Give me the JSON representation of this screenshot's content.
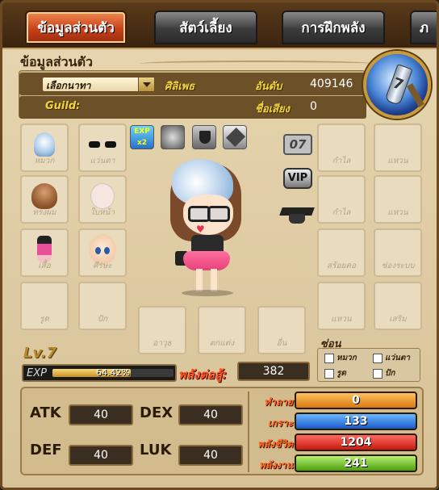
{
  "tabs": [
    {
      "label": "ข้อมูลส่วนตัว"
    },
    {
      "label": "สัตว์เลี้ยง"
    },
    {
      "label": "การฝึกพลัง"
    },
    {
      "label": "ภ"
    }
  ],
  "section_title": "ข้อมูลส่วนตัว",
  "info": {
    "name": "เลือกนาทา",
    "job": "ศิลิเพธ",
    "rank_label": "อันดับ",
    "rank_value": "409146",
    "guild_label": "Guild:",
    "guild_rank_label": "ชื่อเสียง",
    "guild_rank_value": "0"
  },
  "emblem": {
    "number": "7"
  },
  "left_slots": [
    "หมวก",
    "แว่นตา",
    "ทรงผม",
    "ใบหน้า",
    "เสื้อ",
    "ศีรษะ",
    "รูด",
    "ปัก"
  ],
  "right_slots": [
    "กำไล",
    "แหวน",
    "กำไล",
    "แหวน",
    "สร้อยคอ",
    "ช่องระบบ",
    "แหวน",
    "เสริม"
  ],
  "bottom_slots": [
    "อาวุธ",
    "ตกแต่ง",
    "อื่น"
  ],
  "status_icons": {
    "exp_label": "EXP x2"
  },
  "badges": {
    "level_badge": "07",
    "vip_label": "VIP"
  },
  "level": "Lv.7",
  "exp": {
    "label": "EXP",
    "percent_text": "64.42%",
    "fraction": 0.6442
  },
  "power": {
    "label": "พลังต่อสู้:",
    "value": "382"
  },
  "filter": {
    "title": "ซ่อน",
    "items": [
      "หมวก",
      "แว่นตา",
      "รูด",
      "ปัก"
    ]
  },
  "stats": {
    "atk_label": "ATK",
    "atk": "40",
    "dex_label": "DEX",
    "dex": "40",
    "def_label": "DEF",
    "def": "40",
    "luk_label": "LUK",
    "luk": "40"
  },
  "bars": [
    {
      "label": "ทำลาย",
      "value": "0"
    },
    {
      "label": "เกราะ",
      "value": "133"
    },
    {
      "label": "พลังชีวิต",
      "value": "1204"
    },
    {
      "label": "พลังงาน",
      "value": "241"
    }
  ],
  "colors": {
    "active_tab": "#c8421a",
    "gold_text": "#f2d63a",
    "power_red": "#ff5020",
    "bar_orange": "#d87a10",
    "bar_blue": "#1a5ac8",
    "bar_red": "#c81a10",
    "bar_green": "#4aa010"
  }
}
